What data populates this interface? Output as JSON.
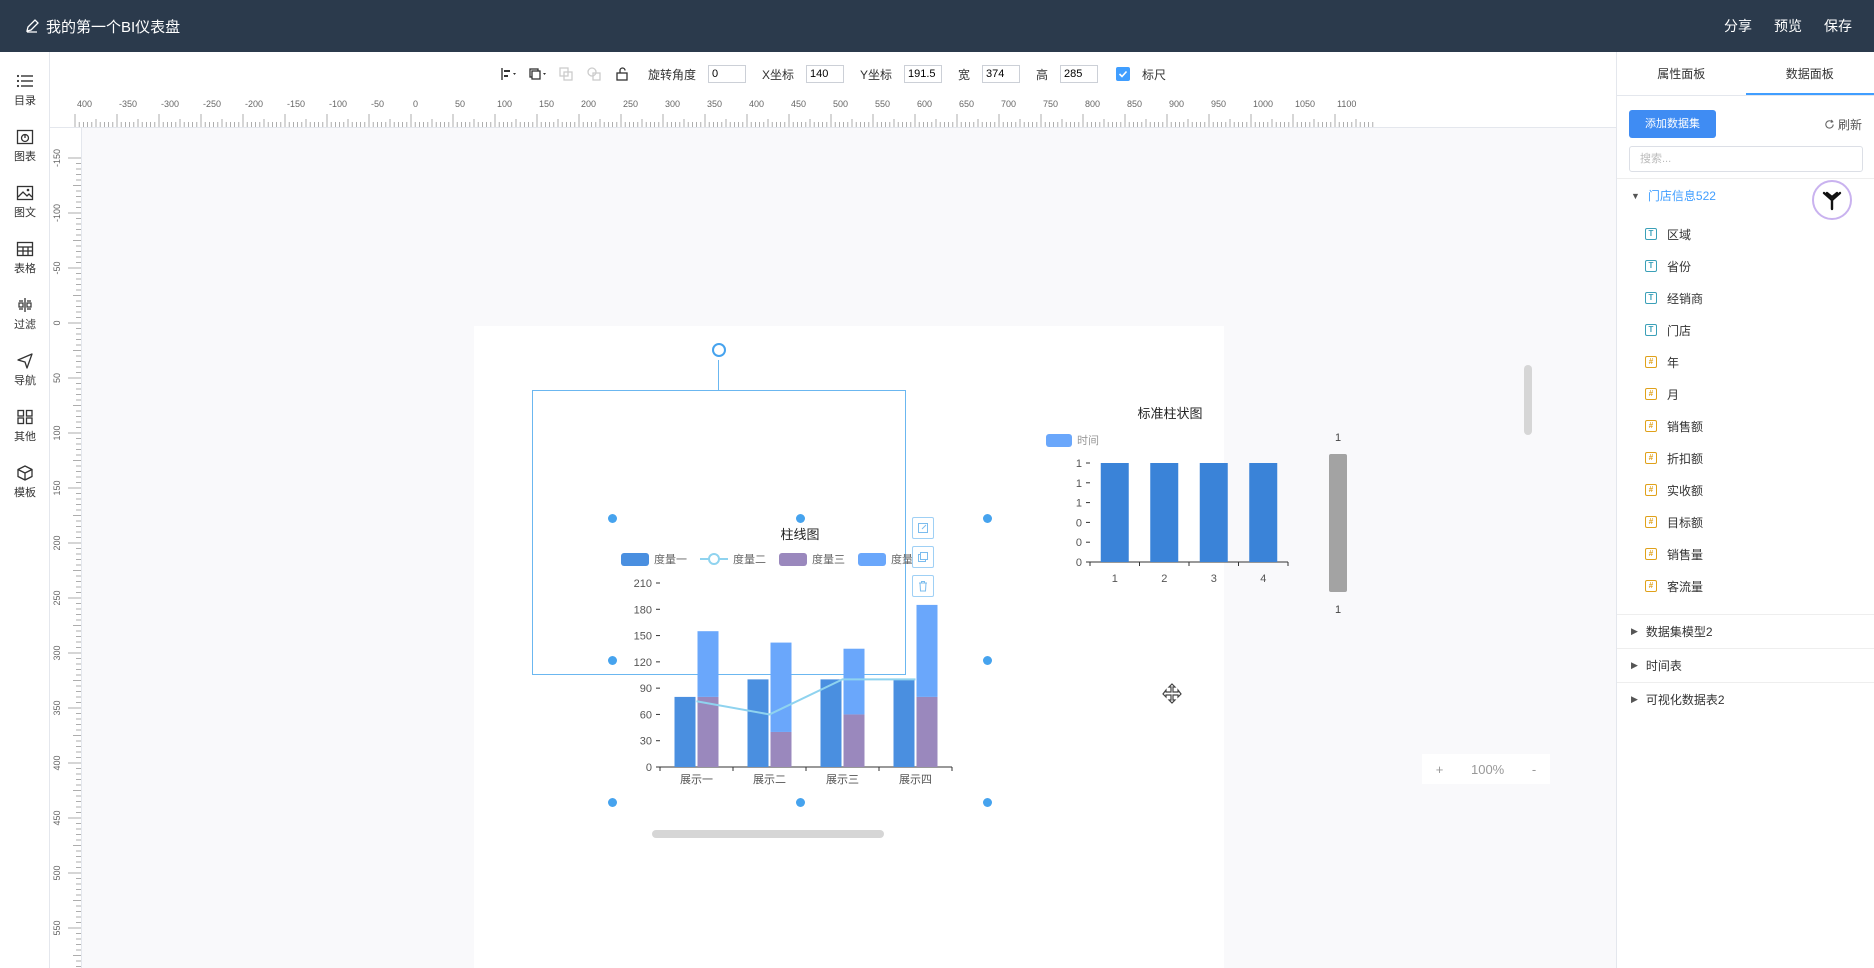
{
  "app": {
    "title": "我的第一个BI仪表盘",
    "actions": [
      "分享",
      "预览",
      "保存"
    ]
  },
  "left_rail": {
    "items": [
      {
        "label": "目录",
        "icon": "list-icon"
      },
      {
        "label": "图表",
        "icon": "chart-icon"
      },
      {
        "label": "图文",
        "icon": "image-text-icon"
      },
      {
        "label": "表格",
        "icon": "table-icon"
      },
      {
        "label": "过滤",
        "icon": "filter-icon"
      },
      {
        "label": "导航",
        "icon": "navigation-icon"
      },
      {
        "label": "其他",
        "icon": "grid-icon"
      },
      {
        "label": "模板",
        "icon": "template-icon"
      }
    ]
  },
  "toolbar": {
    "rotate_label": "旋转角度",
    "rotate_value": "0",
    "x_label": "X坐标",
    "x_value": "140",
    "y_label": "Y坐标",
    "y_value": "191.5",
    "w_label": "宽",
    "w_value": "374",
    "h_label": "高",
    "h_value": "285",
    "ruler_label": "标尺",
    "ruler_checked": true
  },
  "rulers": {
    "horizontal": [
      "400",
      "-350",
      "-300",
      "-250",
      "-200",
      "-150",
      "-100",
      "-50",
      "0",
      "50",
      "100",
      "150",
      "200",
      "250",
      "300",
      "350",
      "400",
      "450",
      "500",
      "550",
      "600",
      "650",
      "700",
      "750",
      "800",
      "850",
      "900",
      "950",
      "1000",
      "1050",
      "1100"
    ],
    "vertical": [
      "-150",
      "-100",
      "-50",
      "0",
      "50",
      "100",
      "150",
      "200",
      "250",
      "300",
      "350",
      "400",
      "450",
      "500",
      "550",
      "600"
    ]
  },
  "zoom": {
    "plus": "+",
    "value": "100%",
    "minus": "-"
  },
  "right_panel": {
    "tabs": [
      "属性面板",
      "数据面板"
    ],
    "active_tab": 1,
    "add_dataset": "添加数据集",
    "refresh": "刷新",
    "search_placeholder": "搜索...",
    "groups": [
      {
        "name": "门店信息522",
        "open": true,
        "fields": [
          {
            "name": "区域",
            "type": "T"
          },
          {
            "name": "省份",
            "type": "T"
          },
          {
            "name": "经销商",
            "type": "T"
          },
          {
            "name": "门店",
            "type": "T"
          },
          {
            "name": "年",
            "type": "N"
          },
          {
            "name": "月",
            "type": "N"
          },
          {
            "name": "销售额",
            "type": "N"
          },
          {
            "name": "折扣额",
            "type": "N"
          },
          {
            "name": "实收额",
            "type": "N"
          },
          {
            "name": "目标额",
            "type": "N"
          },
          {
            "name": "销售量",
            "type": "N"
          },
          {
            "name": "客流量",
            "type": "N"
          }
        ]
      },
      {
        "name": "数据集模型2",
        "open": false,
        "fields": []
      },
      {
        "name": "时间表",
        "open": false,
        "fields": []
      },
      {
        "name": "可视化数据表2",
        "open": false,
        "fields": []
      }
    ]
  },
  "colors": {
    "accent": "#409eff",
    "topbar": "#2b3a4c",
    "bar1": "#4a8fe0",
    "bar3": "#9a88bd",
    "bar4": "#6aa7fb",
    "line2": "#8fd3ef"
  },
  "chart_data": [
    {
      "type": "bar",
      "title": "柱线图",
      "categories": [
        "展示一",
        "展示二",
        "展示三",
        "展示四"
      ],
      "ylim": [
        0,
        210
      ],
      "yticks": [
        0,
        30,
        60,
        90,
        120,
        150,
        180,
        210
      ],
      "legend": "top",
      "series": [
        {
          "name": "度量一",
          "kind": "bar",
          "stack": "a",
          "values": [
            80,
            100,
            100,
            100
          ]
        },
        {
          "name": "度量二",
          "kind": "line",
          "values": [
            75,
            60,
            100,
            100
          ]
        },
        {
          "name": "度量三",
          "kind": "bar",
          "stack": "b",
          "values": [
            80,
            40,
            60,
            80
          ]
        },
        {
          "name": "度量四",
          "kind": "bar",
          "stack": "b",
          "values": [
            75,
            102,
            75,
            105
          ]
        }
      ]
    },
    {
      "type": "bar",
      "title": "标准柱状图",
      "categories": [
        "1",
        "2",
        "3",
        "4"
      ],
      "yticks": [
        "0",
        "0",
        "0",
        "1",
        "1",
        "1"
      ],
      "legend": "top-left",
      "series": [
        {
          "name": "时间",
          "values": [
            1,
            1,
            1,
            1
          ]
        }
      ],
      "slider_labels": [
        "1",
        "1"
      ]
    }
  ]
}
